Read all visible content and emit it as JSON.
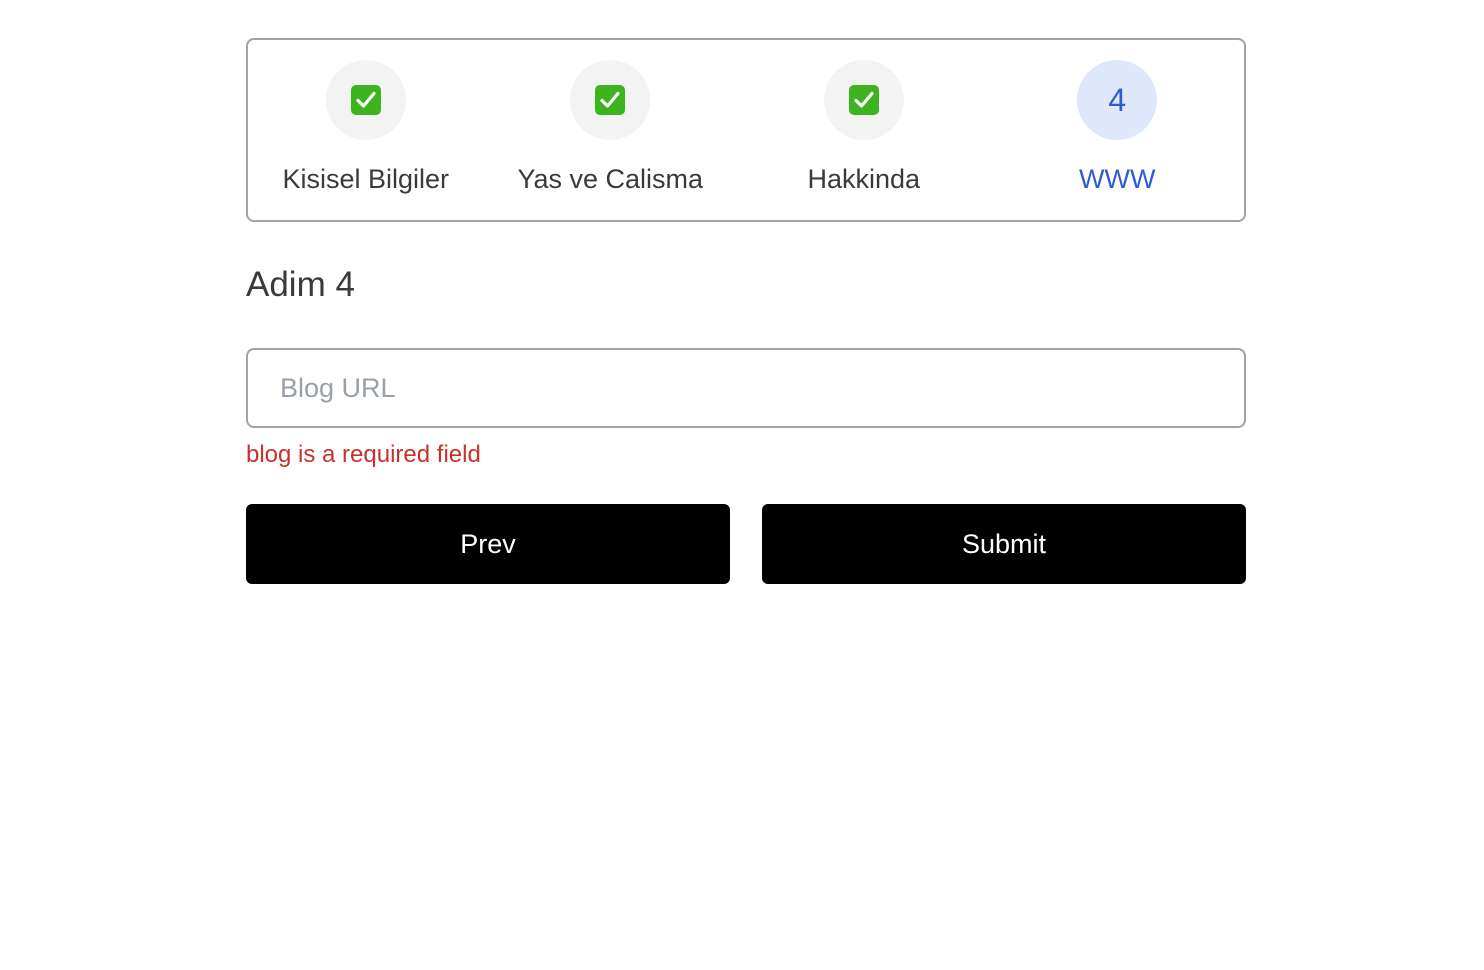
{
  "stepper": {
    "steps": [
      {
        "label": "Kisisel Bilgiler",
        "status": "completed",
        "icon": "check-mark-icon"
      },
      {
        "label": "Yas ve Calisma",
        "status": "completed",
        "icon": "check-mark-icon"
      },
      {
        "label": "Hakkinda",
        "status": "completed",
        "icon": "check-mark-icon"
      },
      {
        "label": "WWW",
        "status": "active",
        "number": "4"
      }
    ],
    "active_color": "#2f5bd6",
    "check_color": "#3db31e"
  },
  "form": {
    "title": "Adim 4",
    "blog_field": {
      "placeholder": "Blog URL",
      "value": ""
    },
    "error": "blog is a required field",
    "error_color": "#c8322b",
    "prev_label": "Prev",
    "submit_label": "Submit"
  }
}
